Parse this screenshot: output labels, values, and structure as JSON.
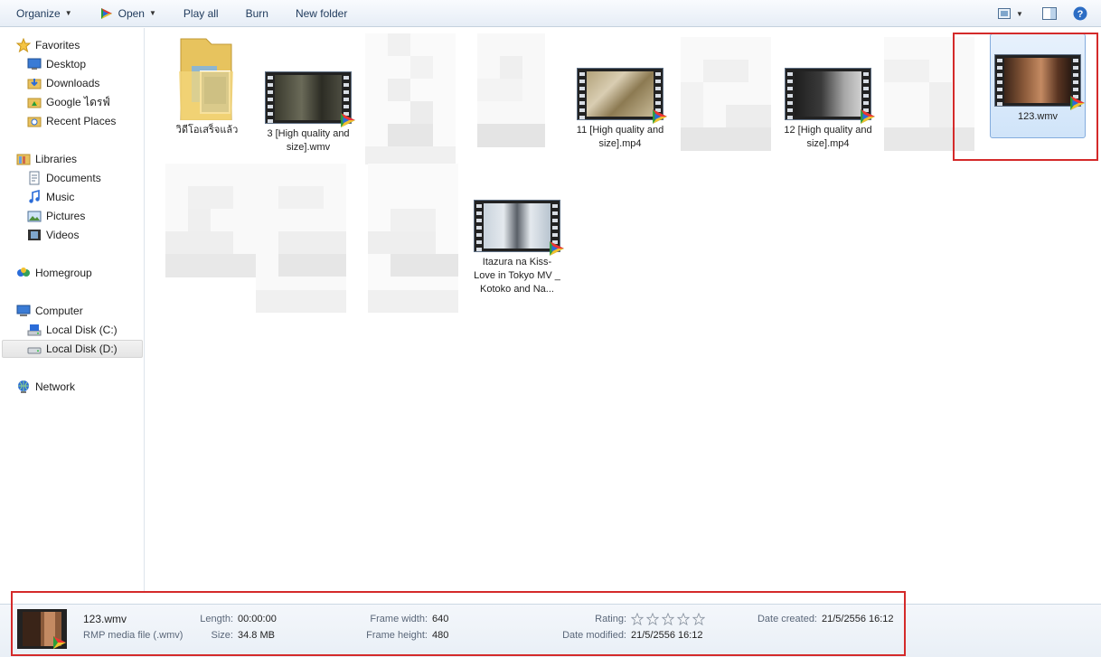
{
  "toolbar": {
    "organize": "Organize",
    "open": "Open",
    "play_all": "Play all",
    "burn": "Burn",
    "new_folder": "New folder",
    "view_icon": "view-options-icon",
    "preview_icon": "preview-pane-icon",
    "help_icon": "help-icon"
  },
  "nav": {
    "favorites": "Favorites",
    "desktop": "Desktop",
    "downloads": "Downloads",
    "google_drive": "Google ไดรฟ์",
    "recent_places": "Recent Places",
    "libraries": "Libraries",
    "documents": "Documents",
    "music": "Music",
    "pictures": "Pictures",
    "videos": "Videos",
    "homegroup": "Homegroup",
    "computer": "Computer",
    "local_c": "Local Disk (C:)",
    "local_d": "Local Disk (D:)",
    "network": "Network"
  },
  "files": {
    "folder": "วิดีโอเสร็จแล้ว",
    "f3": "3 [High quality and size].wmv",
    "f11": "11 [High quality and size].mp4",
    "f12": "12 [High quality and size].mp4",
    "f123": "123.wmv",
    "itazura": "Itazura na Kiss-Love in Tokyo MV _ Kotoko and Na..."
  },
  "details": {
    "name": "123.wmv",
    "type": "RMP media file (.wmv)",
    "length_label": "Length:",
    "length": "00:00:00",
    "size_label": "Size:",
    "size": "34.8 MB",
    "fw_label": "Frame width:",
    "fw": "640",
    "fh_label": "Frame height:",
    "fh": "480",
    "rating_label": "Rating:",
    "rating_stars": 0,
    "modified_label": "Date modified:",
    "modified": "21/5/2556 16:12",
    "created_label": "Date created:",
    "created": "21/5/2556 16:12"
  },
  "colors": {
    "accent": "#1e395b",
    "highlight_box": "#d42a2a",
    "selection": "#cce0f7"
  }
}
